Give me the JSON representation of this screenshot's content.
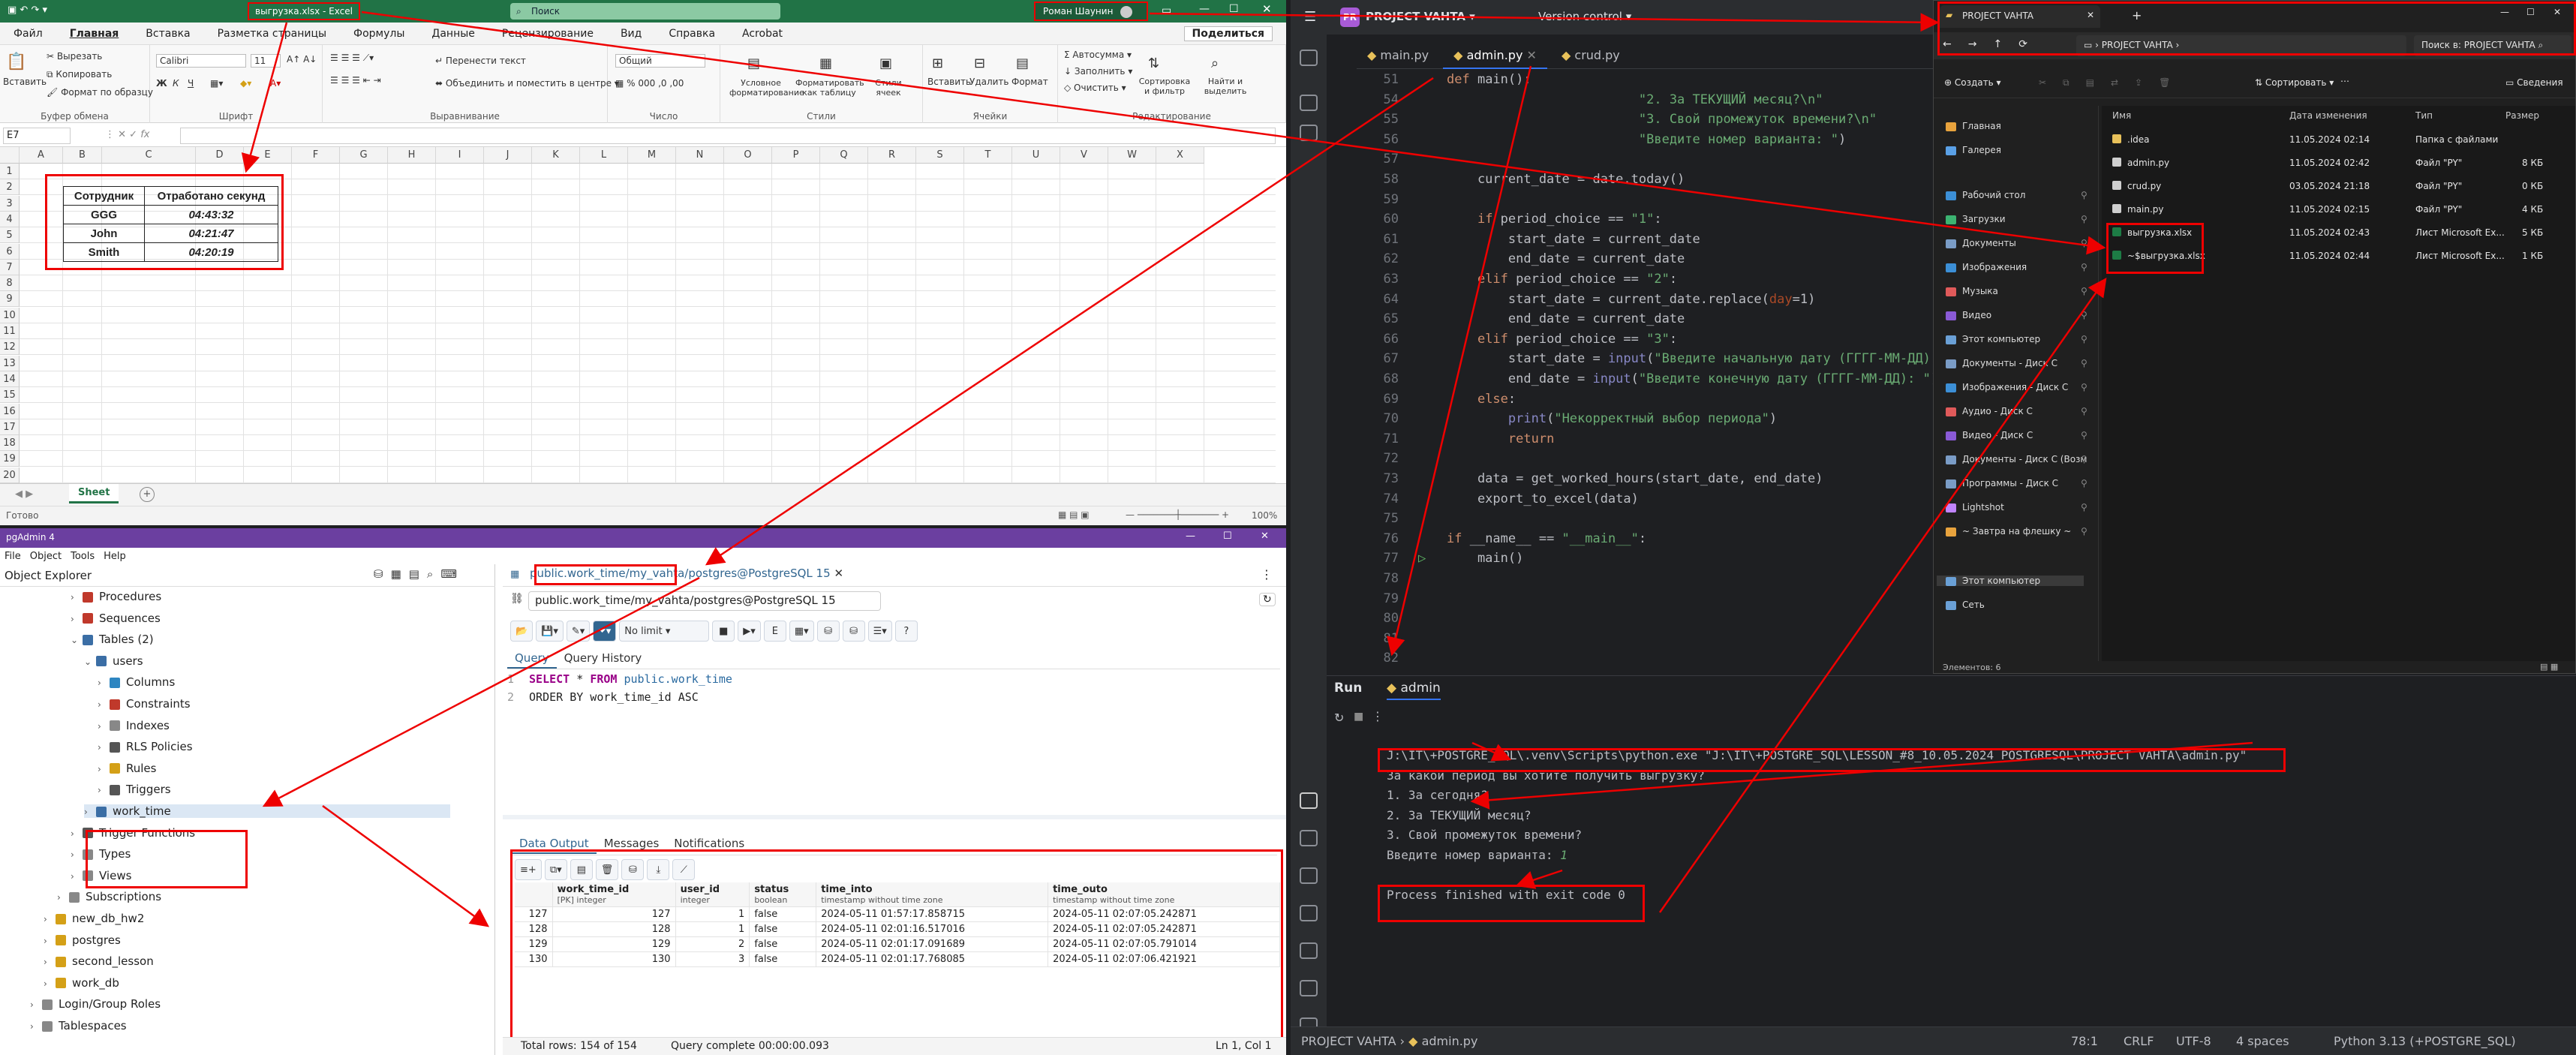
{
  "excel": {
    "title": "выгрузка.xlsx - Excel",
    "search": "Поиск",
    "user": "Роман Шаунин",
    "share": "Поделиться",
    "menu": [
      "Файл",
      "Главная",
      "Вставка",
      "Разметка страницы",
      "Формулы",
      "Данные",
      "Рецензирование",
      "Вид",
      "Справка",
      "Acrobat"
    ],
    "ribbon": {
      "paste": "Вставить",
      "cut": "Вырезать",
      "copy": "Копировать",
      "format_painter": "Формат по образцу",
      "clipboard": "Буфер обмена",
      "font_name": "Calibri",
      "font_size": "11",
      "font": "Шрифт",
      "wrap": "Перенести текст",
      "merge": "Объединить и поместить в центре",
      "alignment": "Выравнивание",
      "number_format": "Общий",
      "number": "Число",
      "cond_format": "Условное форматирование",
      "format_table": "Форматировать как таблицу",
      "cell_styles": "Стили ячеек",
      "styles": "Стили",
      "insert": "Вставить",
      "delete": "Удалить",
      "format": "Формат",
      "cells": "Ячейки",
      "autosum": "Автосумма",
      "fill": "Заполнить",
      "clear": "Очистить",
      "sort": "Сортировка и фильтр",
      "find": "Найти и выделить",
      "editing": "Редактирование"
    },
    "name_box": "E7",
    "formula_symbols": "fx",
    "columns": [
      "A",
      "B",
      "C",
      "D",
      "E",
      "F",
      "G",
      "H",
      "I",
      "J",
      "K",
      "L",
      "M",
      "N",
      "O",
      "P",
      "Q",
      "R",
      "S",
      "T",
      "U",
      "V",
      "W",
      "X"
    ],
    "rows": [
      "1",
      "2",
      "3",
      "4",
      "5",
      "6",
      "7",
      "8",
      "9",
      "10",
      "11",
      "12",
      "13",
      "14",
      "15",
      "16",
      "17",
      "18",
      "19",
      "20"
    ],
    "table": {
      "headers": [
        "Сотрудник",
        "Отработано секунд"
      ],
      "rows": [
        [
          "GGG",
          "04:43:32"
        ],
        [
          "John",
          "04:21:47"
        ],
        [
          "Smith",
          "04:20:19"
        ]
      ]
    },
    "sheet": "Sheet",
    "status_left": "Готово",
    "zoom": "100%"
  },
  "pgadmin": {
    "title": "pgAdmin 4",
    "menu": [
      "File",
      "Object",
      "Tools",
      "Help"
    ],
    "object_explorer": "Object Explorer",
    "tree": [
      {
        "label": "Procedures",
        "indent": 2,
        "icon": "procedures-icon",
        "color": "#c0392b"
      },
      {
        "label": "Sequences",
        "indent": 2,
        "icon": "sequences-icon",
        "color": "#c0392b"
      },
      {
        "label": "Tables (2)",
        "indent": 2,
        "icon": "tables-icon",
        "color": "#3b6ea5"
      },
      {
        "label": "users",
        "indent": 3,
        "icon": "table-icon",
        "color": "#3b6ea5"
      },
      {
        "label": "Columns",
        "indent": 4,
        "icon": "columns-icon",
        "color": "#2e86c1"
      },
      {
        "label": "Constraints",
        "indent": 4,
        "icon": "constraints-icon",
        "color": "#c0392b"
      },
      {
        "label": "Indexes",
        "indent": 4,
        "icon": "indexes-icon",
        "color": "#888"
      },
      {
        "label": "RLS Policies",
        "indent": 4,
        "icon": "rls-icon",
        "color": "#555"
      },
      {
        "label": "Rules",
        "indent": 4,
        "icon": "rules-icon",
        "color": "#d4a017"
      },
      {
        "label": "Triggers",
        "indent": 4,
        "icon": "triggers-icon",
        "color": "#555"
      },
      {
        "label": "work_time",
        "indent": 3,
        "icon": "table-icon",
        "color": "#3b6ea5"
      },
      {
        "label": "Trigger Functions",
        "indent": 2,
        "icon": "trigger-functions-icon",
        "color": "#555"
      },
      {
        "label": "Types",
        "indent": 2,
        "icon": "types-icon",
        "color": "#888"
      },
      {
        "label": "Views",
        "indent": 2,
        "icon": "views-icon",
        "color": "#888"
      },
      {
        "label": "Subscriptions",
        "indent": 1,
        "icon": "subscriptions-icon",
        "color": "#888"
      },
      {
        "label": "new_db_hw2",
        "indent": 0,
        "icon": "database-icon",
        "color": "#d4a017"
      },
      {
        "label": "postgres",
        "indent": 0,
        "icon": "database-icon",
        "color": "#d4a017"
      },
      {
        "label": "second_lesson",
        "indent": 0,
        "icon": "database-icon",
        "color": "#d4a017"
      },
      {
        "label": "work_db",
        "indent": 0,
        "icon": "database-icon",
        "color": "#d4a017"
      },
      {
        "label": "Login/Group Roles",
        "indent": -1,
        "icon": "roles-icon",
        "color": "#888"
      },
      {
        "label": "Tablespaces",
        "indent": -1,
        "icon": "tablespaces-icon",
        "color": "#888"
      }
    ],
    "query_tab": "public.work_time/my_vahta/postgres@PostgreSQL 15",
    "connection": "public.work_time/my_vahta/postgres@PostgreSQL 15",
    "no_limit": "No limit",
    "tabs": [
      "Query",
      "Query History"
    ],
    "sql_line1_kw": "SELECT",
    "sql_line1_rest": " * ",
    "sql_line1_kw2": "FROM",
    "sql_line1_tbl": " public.work_time",
    "sql_line2": "ORDER BY work_time_id ASC",
    "output_tabs": [
      "Data Output",
      "Messages",
      "Notifications"
    ],
    "columns": [
      {
        "name": "work_time_id",
        "type": "[PK] integer"
      },
      {
        "name": "user_id",
        "type": "integer"
      },
      {
        "name": "status",
        "type": "boolean"
      },
      {
        "name": "time_into",
        "type": "timestamp without time zone"
      },
      {
        "name": "time_outo",
        "type": "timestamp without time zone"
      }
    ],
    "rows": [
      [
        "127",
        "127",
        "1",
        "false",
        "2024-05-11 01:57:17.858715",
        "2024-05-11 02:07:05.242871"
      ],
      [
        "128",
        "128",
        "1",
        "false",
        "2024-05-11 02:01:16.517016",
        "2024-05-11 02:07:05.242871"
      ],
      [
        "129",
        "129",
        "2",
        "false",
        "2024-05-11 02:01:17.091689",
        "2024-05-11 02:07:05.791014"
      ],
      [
        "130",
        "130",
        "3",
        "false",
        "2024-05-11 02:01:17.768085",
        "2024-05-11 02:07:06.421921"
      ]
    ],
    "total_rows": "Total rows: 154 of 154",
    "query_complete": "Query complete 00:00:00.093",
    "cursor": "Ln 1, Col 1"
  },
  "pycharm": {
    "project": "PROJECT VAHTA",
    "project_badge": "PR",
    "vcs": "Version control",
    "tabs": [
      "main.py",
      "admin.py",
      "crud.py"
    ],
    "code": [
      {
        "n": "51",
        "t": "def main():"
      },
      {
        "n": "54",
        "t": "                         \"2. За ТЕКУЩИЙ месяц?\\n\""
      },
      {
        "n": "55",
        "t": "                         \"3. Свой промежуток времени?\\n\""
      },
      {
        "n": "56",
        "t": "                         \"Введите номер варианта: \")"
      },
      {
        "n": "57",
        "t": ""
      },
      {
        "n": "58",
        "t": "    current_date = date.today()"
      },
      {
        "n": "59",
        "t": ""
      },
      {
        "n": "60",
        "t": "    if period_choice == \"1\":"
      },
      {
        "n": "61",
        "t": "        start_date = current_date"
      },
      {
        "n": "62",
        "t": "        end_date = current_date"
      },
      {
        "n": "63",
        "t": "    elif period_choice == \"2\":"
      },
      {
        "n": "64",
        "t": "        start_date = current_date.replace(day=1)"
      },
      {
        "n": "65",
        "t": "        end_date = current_date"
      },
      {
        "n": "66",
        "t": "    elif period_choice == \"3\":"
      },
      {
        "n": "67",
        "t": "        start_date = input(\"Введите начальную дату (ГГГГ-ММ-ДД): \")"
      },
      {
        "n": "68",
        "t": "        end_date = input(\"Введите конечную дату (ГГГГ-ММ-ДД): \")"
      },
      {
        "n": "69",
        "t": "    else:"
      },
      {
        "n": "70",
        "t": "        print(\"Некорректный выбор периода\")"
      },
      {
        "n": "71",
        "t": "        return"
      },
      {
        "n": "72",
        "t": ""
      },
      {
        "n": "73",
        "t": "    data = get_worked_hours(start_date, end_date)"
      },
      {
        "n": "74",
        "t": "    export_to_excel(data)"
      },
      {
        "n": "75",
        "t": ""
      },
      {
        "n": "76",
        "t": "if __name__ == \"__main__\":"
      },
      {
        "n": "77",
        "t": "    main()"
      },
      {
        "n": "78",
        "t": ""
      },
      {
        "n": "79",
        "t": ""
      },
      {
        "n": "80",
        "t": ""
      },
      {
        "n": "81",
        "t": ""
      },
      {
        "n": "82",
        "t": ""
      }
    ],
    "run_label": "Run",
    "run_config": "admin",
    "console": [
      "J:\\IT\\+POSTGRE_SQL\\.venv\\Scripts\\python.exe \"J:\\IT\\+POSTGRE_SQL\\LESSON_#8_10.05.2024_POSTGRESQL\\PROJECT VAHTA\\admin.py\"",
      "За какой период вы хотите получить выгрузку?",
      "1. За сегодня?",
      "2. За ТЕКУЩИЙ месяц?",
      "3. Свой промежуток времени?",
      "Введите номер варианта: ",
      "",
      "Process finished with exit code 0"
    ],
    "console_input": "1",
    "status": {
      "breadcrumb_project": "PROJECT VAHTA",
      "breadcrumb_file": "admin.py",
      "position": "78:1",
      "line_sep": "CRLF",
      "encoding": "UTF-8",
      "indent": "4 spaces",
      "interpreter": "Python 3.13 (+POSTGRE_SQL)"
    }
  },
  "explorer": {
    "title": "PROJECT VAHTA",
    "path": "PROJECT VAHTA",
    "search": "Поиск в: PROJECT VAHTA",
    "create": "Создать",
    "sort": "Сортировать",
    "details": "Сведения",
    "nav": [
      {
        "label": "Главная",
        "color": "#e8a33d"
      },
      {
        "label": "Галерея",
        "color": "#5aa0e6"
      },
      {
        "label": "Рабочий стол",
        "color": "#3c8fd6"
      },
      {
        "label": "Загрузки",
        "color": "#3cb371"
      },
      {
        "label": "Документы",
        "color": "#7a9cc6"
      },
      {
        "label": "Изображения",
        "color": "#3c8fd6"
      },
      {
        "label": "Музыка",
        "color": "#e05a5a"
      },
      {
        "label": "Видео",
        "color": "#8a5ad6"
      },
      {
        "label": "Этот компьютер",
        "color": "#6aa0d6"
      },
      {
        "label": "Документы - Диск С",
        "color": "#7a9cc6"
      },
      {
        "label": "Изображения - Диск С",
        "color": "#3c8fd6"
      },
      {
        "label": "Аудио - Диск С",
        "color": "#e05a5a"
      },
      {
        "label": "Видео - Диск С",
        "color": "#8a5ad6"
      },
      {
        "label": "Документы - Диск С (Возм",
        "color": "#7a9cc6"
      },
      {
        "label": "Программы - Диск С",
        "color": "#7a9cc6"
      },
      {
        "label": "Lightshot",
        "color": "#c084fc"
      },
      {
        "label": "~ Завтра на флешку ~",
        "color": "#e8a33d"
      },
      {
        "label": "Этот компьютер",
        "color": "#6aa0d6"
      },
      {
        "label": "Сеть",
        "color": "#6aa0d6"
      }
    ],
    "headers": [
      "Имя",
      "Дата изменения",
      "Тип",
      "Размер"
    ],
    "files": [
      {
        "name": ".idea",
        "date": "11.05.2024 02:14",
        "type": "Папка с файлами",
        "size": "",
        "color": "#e8c15a"
      },
      {
        "name": "admin.py",
        "date": "11.05.2024 02:42",
        "type": "Файл \"PY\"",
        "size": "8 КБ",
        "color": "#cfcfcf"
      },
      {
        "name": "crud.py",
        "date": "03.05.2024 21:18",
        "type": "Файл \"PY\"",
        "size": "0 КБ",
        "color": "#cfcfcf"
      },
      {
        "name": "main.py",
        "date": "11.05.2024 02:15",
        "type": "Файл \"PY\"",
        "size": "4 КБ",
        "color": "#cfcfcf"
      },
      {
        "name": "выгрузка.xlsx",
        "date": "11.05.2024 02:43",
        "type": "Лист Microsoft Ex...",
        "size": "5 КБ",
        "color": "#1d7c45"
      },
      {
        "name": "~$выгрузка.xlsx",
        "date": "11.05.2024 02:44",
        "type": "Лист Microsoft Ex...",
        "size": "1 КБ",
        "color": "#1d7c45"
      }
    ],
    "status": "Элементов: 6"
  }
}
